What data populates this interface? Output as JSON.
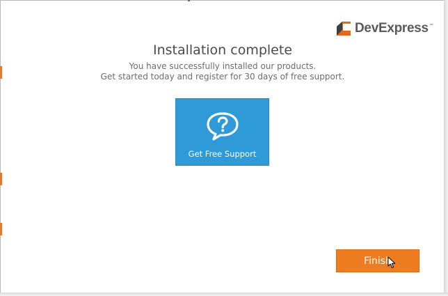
{
  "logo": {
    "name_part1": "Dev",
    "name_part2": "Express",
    "trademark": "™",
    "mark_icon": "devexpress-logo-icon"
  },
  "main": {
    "title": "Installation complete",
    "subtitle_line1": "You have successfully installed our products.",
    "subtitle_line2": "Get started today and register for 30 days of free support."
  },
  "support_tile": {
    "label": "Get Free Support",
    "icon": "question-speech-bubble-icon",
    "color": "#2e9ad8"
  },
  "footer": {
    "finish_label": "Finish",
    "finish_color": "#ee7d21"
  },
  "cursor": {
    "icon": "mouse-pointer-icon"
  }
}
